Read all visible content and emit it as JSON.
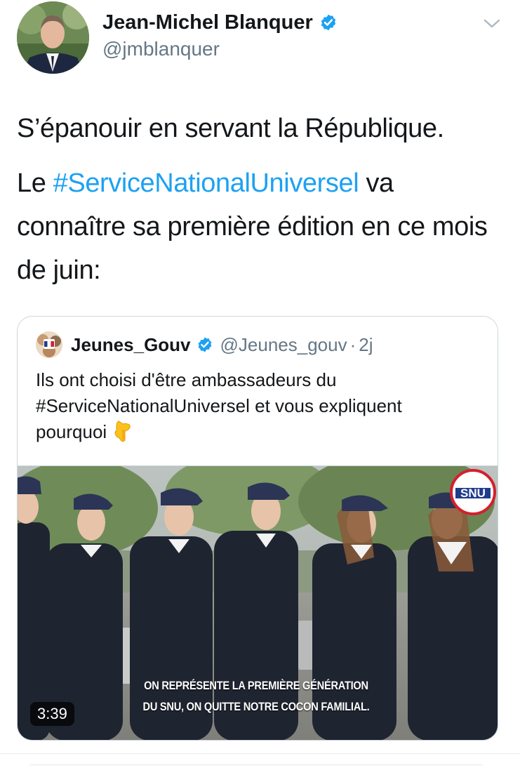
{
  "author": {
    "name": "Jean-Michel Blanquer",
    "handle": "@jmblanquer",
    "verified": true
  },
  "tweet": {
    "line1": "S’épanouir en servant la République.",
    "line2_prefix": "Le ",
    "hashtag": "#ServiceNationalUniversel",
    "line2_suffix": " va connaître sa première édition en ce mois de juin:"
  },
  "quoted_tweet": {
    "name": "Jeunes_Gouv",
    "handle": "@Jeunes_gouv",
    "separator": "·",
    "time": "2j",
    "text_line1": "Ils ont choisi d'être ambassadeurs du",
    "text_line2": "#ServiceNationalUniversel et vous expliquent",
    "text_line3": "pourquoi",
    "emoji": "pointing-down-emoji",
    "video": {
      "duration": "3:39",
      "subtitle_line1": "ON REPRÉSENTE LA PREMIÈRE GÉNÉRATION",
      "subtitle_line2": "DU SNU, ON QUITTE NOTRE COCON FAMILIAL.",
      "logo_text": "SNU"
    }
  },
  "colors": {
    "link": "#1da1f2",
    "secondary_text": "#657786",
    "border": "#ccd6dd",
    "verified": "#1da1f2"
  }
}
